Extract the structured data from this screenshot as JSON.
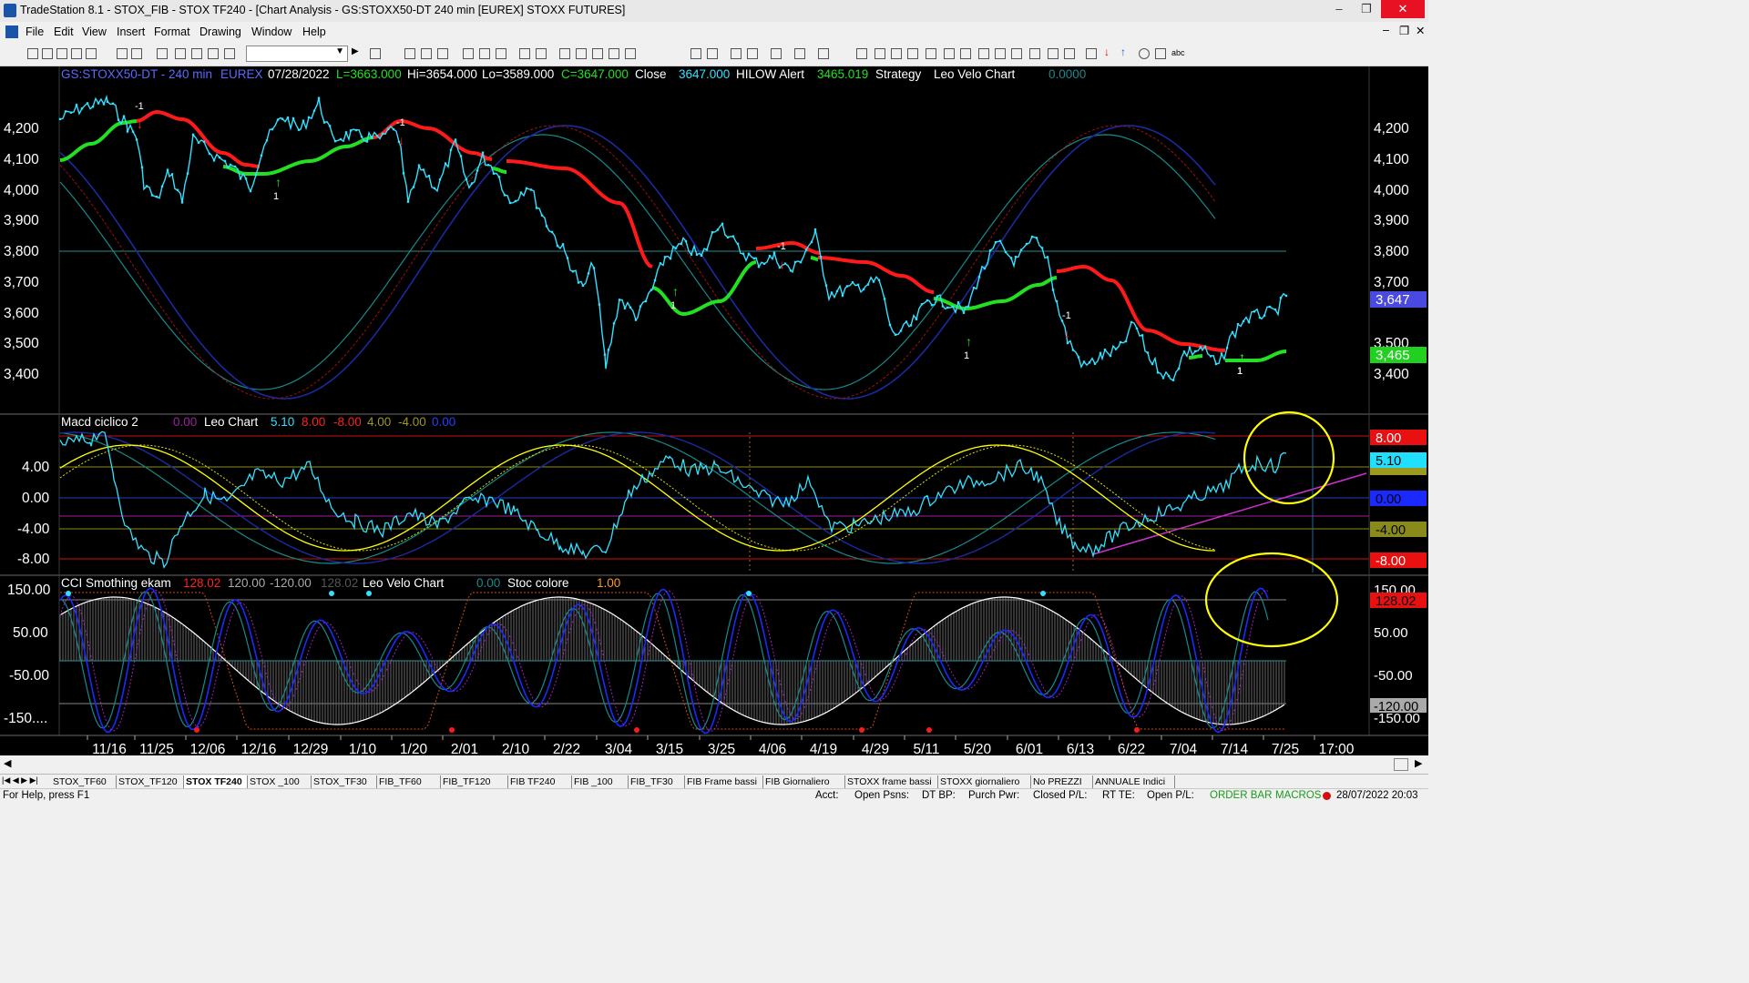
{
  "window": {
    "title": "TradeStation 8.1 - STOX_FIB - STOX TF240 - [Chart Analysis - GS:STOXX50-DT  240 min  [EUREX] STOXX FUTURES]",
    "minimize": "–",
    "restore": "❐",
    "close": "✕"
  },
  "menu": [
    "File",
    "Edit",
    "View",
    "Insert",
    "Format",
    "Drawing",
    "Window",
    "Help"
  ],
  "price_panel": {
    "symbol": "GS:STOXX50-DT - 240 min",
    "exchange": "EUREX",
    "date": "07/28/2022",
    "last": "L=3663.000",
    "high": "Hi=3654.000",
    "low": "Lo=3589.000",
    "close_val": "C=3647.000",
    "close_label": "Close",
    "close_num": "3647.000",
    "alert_label": "HILOW Alert",
    "alert_val": "3465.019",
    "strategy_label": "Strategy",
    "leo_label": "Leo Velo Chart",
    "leo_val": "0.0000",
    "y_ticks": [
      "4,200",
      "4,100",
      "4,000",
      "3,900",
      "3,800",
      "3,700",
      "3,600",
      "3,500",
      "3,400"
    ],
    "price_tag": "3,647",
    "alert_tag": "3,465",
    "signal_labels": [
      "-1",
      "1",
      "-1",
      "1",
      "-1",
      "1",
      "-1",
      "1",
      "1"
    ]
  },
  "macd_panel": {
    "name": "Macd ciclico 2",
    "v0": "0.00",
    "leo": "Leo Chart",
    "v1": "5.10",
    "v2": "8.00",
    "v3": "-8.00",
    "v4": "4.00",
    "v5": "-4.00",
    "v6": "0.00",
    "y_ticks": [
      "4.00",
      "0.00",
      "-4.00",
      "-8.00"
    ],
    "tags": [
      "8.00",
      "5.10",
      "4.00",
      "0.00",
      "-4.00",
      "-8.00"
    ]
  },
  "cci_panel": {
    "name": "CCI Smothing ekam",
    "v1": "128.02",
    "v2": "120.00",
    "v3": "-120.00",
    "v4": "128.02",
    "leo": "Leo Velo Chart",
    "v5": "0.00",
    "stoc": "Stoc colore",
    "v6": "1.00",
    "y_ticks": [
      "150.00",
      "50.00",
      "-50.00",
      "-150...."
    ],
    "tags": [
      "150.00",
      "128.02",
      "50.00",
      "-50.00",
      "-120.00",
      "-150.00"
    ]
  },
  "x_axis": [
    "11/16",
    "11/25",
    "12/06",
    "12/16",
    "12/29",
    "1/10",
    "1/20",
    "2/01",
    "2/10",
    "2/22",
    "3/04",
    "3/15",
    "3/25",
    "4/06",
    "4/19",
    "4/29",
    "5/11",
    "5/20",
    "6/01",
    "6/13",
    "6/22",
    "7/04",
    "7/14",
    "7/25",
    "17:00"
  ],
  "tabs": [
    "STOX_TF60",
    "STOX_TF120",
    "STOX TF240",
    "STOX _100",
    "STOX_TF30",
    "FIB_TF60",
    "FIB_TF120",
    "FIB TF240",
    "FIB _100",
    "FIB_TF30",
    "FIB Frame bassi",
    "FIB Giornaliero",
    "STOXX frame bassi",
    "STOXX giornaliero",
    "No PREZZI",
    "ANNUALE Indici"
  ],
  "active_tab": "STOX TF240",
  "status": {
    "help": "For Help, press F1",
    "acct": "Acct:",
    "open_psns": "Open Psns:",
    "dt_bp": "DT BP:",
    "purch_pwr": "Purch Pwr:",
    "closed_pl": "Closed P/L:",
    "rt_te": "RT TE:",
    "open_pl": "Open P/L:",
    "order_bar": "ORDER BAR",
    "macros": "MACROS",
    "datetime": "28/07/2022 20:03"
  },
  "colors": {
    "price": "#33e0ff",
    "up_trend": "#22e022",
    "down_trend": "#ff1a1a",
    "navy": "#1a2aa0",
    "yellow": "#ffff00",
    "magenta": "#c020c0",
    "teal": "#20a0a0"
  }
}
